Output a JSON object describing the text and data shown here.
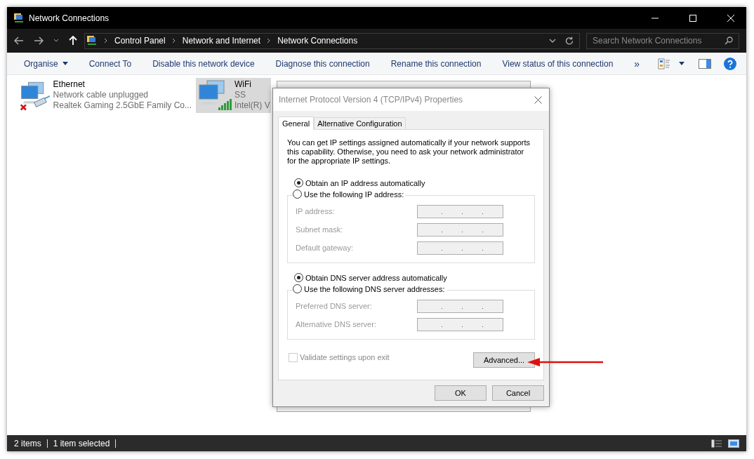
{
  "window": {
    "title": "Network Connections"
  },
  "address_bar": {
    "path": [
      "Control Panel",
      "Network and Internet",
      "Network Connections"
    ]
  },
  "search": {
    "placeholder": "Search Network Connections"
  },
  "toolbar": {
    "items": [
      {
        "label": "Organise",
        "kind": "menu"
      },
      {
        "label": "Connect To",
        "kind": "plain"
      },
      {
        "label": "Disable this network device",
        "kind": "plain"
      },
      {
        "label": "Diagnose this connection",
        "kind": "plain"
      },
      {
        "label": "Rename this connection",
        "kind": "plain"
      },
      {
        "label": "View status of this connection",
        "kind": "plain"
      }
    ],
    "overflow": "»"
  },
  "connections": [
    {
      "name": "Ethernet",
      "status": "Network cable unplugged",
      "device": "Realtek Gaming 2.5GbE Family Co...",
      "kind": "wired",
      "selected": false
    },
    {
      "name": "WiFi",
      "status": "SS",
      "device": "Intel(R) V",
      "kind": "wireless",
      "selected": true
    }
  ],
  "dialog": {
    "title": "Internet Protocol Version 4 (TCP/IPv4) Properties",
    "tabs": [
      {
        "label": "General",
        "selected": true
      },
      {
        "label": "Alternative Configuration",
        "selected": false
      }
    ],
    "description": "You can get IP settings assigned automatically if your network supports this capability. Otherwise, you need to ask your network administrator for the appropriate IP settings.",
    "ip_settings": {
      "options": [
        {
          "label": "Obtain an IP address automatically",
          "selected": true
        },
        {
          "label": "Use the following IP address:",
          "selected": false
        }
      ],
      "fields": [
        {
          "label": "IP address:",
          "disabled": true
        },
        {
          "label": "Subnet mask:",
          "disabled": true
        },
        {
          "label": "Default gateway:",
          "disabled": true
        }
      ]
    },
    "dns_settings": {
      "options": [
        {
          "label": "Obtain DNS server address automatically",
          "selected": true
        },
        {
          "label": "Use the following DNS server addresses:",
          "selected": false
        }
      ],
      "fields": [
        {
          "label": "Preferred DNS server:",
          "disabled": true
        },
        {
          "label": "Alternative DNS server:",
          "disabled": true
        }
      ]
    },
    "validate": {
      "label": "Validate settings upon exit",
      "checked": false,
      "disabled": true
    },
    "advanced_button": "Advanced...",
    "buttons": [
      "OK",
      "Cancel"
    ]
  },
  "status_bar": {
    "items": [
      "2 items",
      "1 item selected"
    ]
  }
}
